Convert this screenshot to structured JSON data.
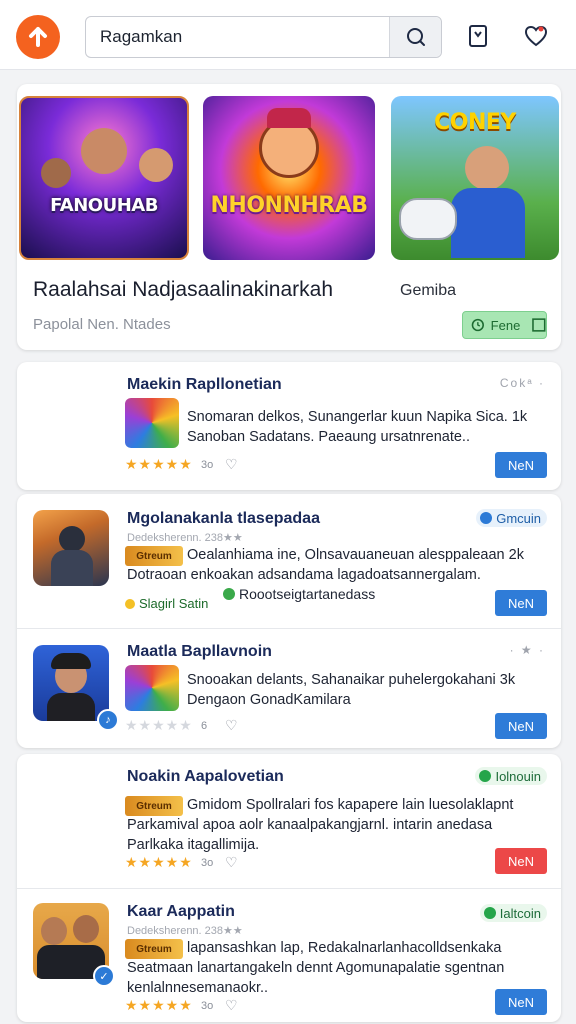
{
  "header": {
    "search_value": "Ragamkan",
    "search_placeholder": "Ragamkan"
  },
  "featured": {
    "banners": [
      {
        "title": "FANOUHAB"
      },
      {
        "title": "NHONNHRAB"
      },
      {
        "title": "CONEY"
      }
    ],
    "title": "Raalahsai Nadjasaalinakinarkah",
    "genre": "Gemiba",
    "subtitle": "Papolal Nen. Ntades",
    "badge_label": "Fene"
  },
  "apps": [
    {
      "title": "Maekin Rapllonetian",
      "meta_right": "Cokᵃ ·",
      "desc_1": "Snomaran delkos, Sunangerlar kuun Napika Sica. 1k",
      "desc_2": "Sanoban Sadatans. Paeaung ursatnrenate..",
      "rating_count": "3o",
      "button": "NeN",
      "button_color": "#2f7cd8"
    },
    {
      "title": "Mgolanakanla tlasepadaa",
      "status": "Gmcuin",
      "sub_meta": "Dedeksherenn. 238★★",
      "thumb_label": "Gtreum",
      "desc_1": "Oealanhiama ine, Olnsavauaneuan alesppaleaan 2k",
      "desc_2": "Dotraoan enkoakan adsandama lagadoatsannergalam.",
      "tag": "Slagirl Satin",
      "inline_tag": "Roootseigtartanedass",
      "button": "NeN",
      "button_color": "#2f7cd8"
    },
    {
      "title": "Maatla Bapllavnoin",
      "meta_right": "· ★ ·",
      "desc_1": "Snooakan delants, Sahanaikar puhelergokahani  3k",
      "desc_2": "Dengaon GonadKamilara",
      "rating_count": "6",
      "button": "NeN",
      "button_color": "#2f7cd8"
    },
    {
      "title": "Noakin Aapalovetian",
      "status": "Iolnouin",
      "thumb_label": "Gtreum",
      "desc_1": "Gmidom Spollralari fos kapapere lain luesolaklapnt",
      "desc_2": "Parkamival apoa aolr kanaalpakangjarnl. intarin anedasa",
      "desc_3": "Parlkaka itagallimija.",
      "rating_count": "3o",
      "button": "NeN",
      "button_color": "#ec4848"
    },
    {
      "title": "Kaar Aappatin",
      "status": "Ialtcoin",
      "sub_meta": "Dedeksherenn. 238★★",
      "thumb_label": "Gtreum",
      "desc_1": "lapansashkan lap, Redakalnarlanhacolldsenkaka",
      "desc_2": "Seatmaan lanartangakeln dennt Agomunapalatie sgentnan",
      "desc_3": "kenlalnnesemanaokr..",
      "rating_count": "3o",
      "button": "NeN",
      "button_color": "#2f7cd8"
    }
  ],
  "colors": {
    "accent": "#f4621f",
    "primary_button": "#2f7cd8",
    "danger_button": "#ec4848",
    "star": "#f5a623",
    "status_green": "#25a54a"
  },
  "icons": [
    "add-icon",
    "search-icon",
    "bookmark-icon",
    "heart-icon",
    "star-icon",
    "verified-icon"
  ]
}
